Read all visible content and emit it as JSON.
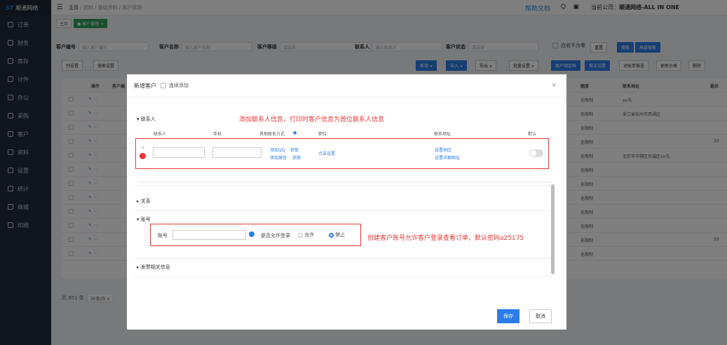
{
  "brand": "顺通网络",
  "sidebar": [
    "订单",
    "财务",
    "库存",
    "计件",
    "办公",
    "采购",
    "客户",
    "资料",
    "设置",
    "统计",
    "商城",
    "印刷"
  ],
  "breadcrumb": {
    "home": "主页",
    "a": "资料",
    "b": "基础资料",
    "c": "客户管理"
  },
  "header": {
    "help": "帮助文档",
    "company_label": "当前公司：",
    "company": "顺通网络-ALL IN ONE"
  },
  "tabs": {
    "home": "主页",
    "active": "● 客户管理 ×"
  },
  "search": {
    "code_label": "客户编号",
    "code_ph": "输入客户编号",
    "name_label": "客户名称",
    "name_ph": "输入客户名称",
    "level_label": "客户等级",
    "level_ph": "请选择",
    "contact_label": "联系人",
    "contact_ph": "输入联系人",
    "status_label": "客户状态",
    "status_ph": "请选择",
    "nonzero": "应收不为零",
    "reset": "重置",
    "search": "搜索",
    "adv": "高级搜索"
  },
  "buttons": {
    "colset": "列设置",
    "searchset": "搜索设置",
    "new": "新增 ∨",
    "import": "导入 ∨",
    "export": "导出 ∨",
    "batch": "批量设置 ∨",
    "bind": "客户绑定码",
    "pushset": "推送设置",
    "recon": "对账单推送",
    "price": "更新价格",
    "del": "删除"
  },
  "table": {
    "ops": "操作",
    "cust": "客户编",
    "limit": "额度",
    "addr": "联系地址",
    "last": "最后",
    "rows": [
      [
        "无限制",
        "xx屯",
        ""
      ],
      [
        "无限制",
        "浙江省杭州市西湖区",
        ""
      ],
      [
        "无限制",
        "",
        ""
      ],
      [
        "无限制",
        "",
        "20"
      ],
      [
        "无限制",
        "北京市市辖区东城区xx屯",
        ""
      ],
      [
        "无限制",
        "",
        ""
      ],
      [
        "无限制",
        "",
        ""
      ],
      [
        "无限制",
        "",
        ""
      ],
      [
        "无限制",
        "",
        ""
      ],
      [
        "无限制",
        "",
        ""
      ],
      [
        "无限制",
        "",
        "20"
      ],
      [
        "无限制",
        "",
        ""
      ]
    ]
  },
  "pager": {
    "total": "共 851 条",
    "size": "30条/页 ∨"
  },
  "dialog": {
    "title": "新增客户",
    "continuous": "连续添加",
    "contact_section": "▾ 联系人",
    "contact_note": "添加联系人信息，打印时客户信息为首位联系人信息",
    "cols": [
      "联系人",
      "手机",
      "其他联系方式",
      "职位",
      "联系地址",
      "默认"
    ],
    "add_qq": "添加QQ",
    "get1": "获取",
    "add_wx": "添加微信",
    "get2": "获取",
    "set": "点击设置",
    "set_area": "设置地区",
    "set_addr": "设置详细地址",
    "rel_section": "▸ 关系",
    "acct_section": "▾ 账号",
    "acct_label": "账号",
    "allow_label": "是否允许登录",
    "allow": "允许",
    "forbid": "禁止",
    "acct_note": "创建客户账号允许客户登录查看订单，默认密码a25175",
    "invoice_section": "▸ 发票相关信息",
    "save": "保存",
    "cancel": "取消"
  }
}
